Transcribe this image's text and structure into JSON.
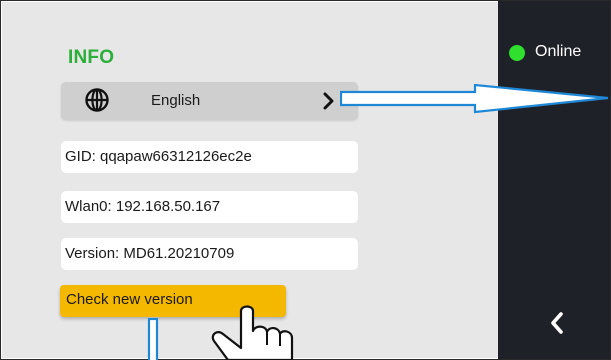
{
  "info": {
    "title": "INFO",
    "language": {
      "label": "English",
      "icon": "globe-icon",
      "chevron": "chevron-right-icon"
    },
    "fields": [
      {
        "name": "gid",
        "text": "GID: qqapaw66312126ec2e"
      },
      {
        "name": "wlan",
        "text": "Wlan0: 192.168.50.167"
      },
      {
        "name": "version",
        "text": "Version: MD61.20210709"
      }
    ],
    "check_button": "Check new version"
  },
  "sidebar": {
    "status": {
      "label": "Online",
      "color": "#2fe02f"
    },
    "back_icon": "chevron-left-icon"
  },
  "colors": {
    "accent_title": "#2bae3a",
    "button": "#f4b800",
    "sidebar_bg": "#1e2128",
    "panel_bg": "#e7e7e7",
    "callout_arrow": "#1e88d6"
  }
}
